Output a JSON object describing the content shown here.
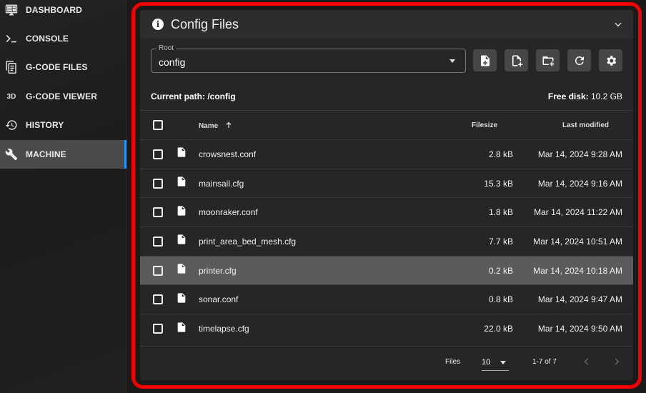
{
  "sidebar": {
    "items": [
      {
        "label": "DASHBOARD",
        "icon": "monitor-dashboard-icon"
      },
      {
        "label": "CONSOLE",
        "icon": "console-icon"
      },
      {
        "label": "G-CODE FILES",
        "icon": "file-document-icon"
      },
      {
        "label": "G-CODE VIEWER",
        "icon": "3d-icon",
        "icon_text": "3D"
      },
      {
        "label": "HISTORY",
        "icon": "history-icon"
      },
      {
        "label": "MACHINE",
        "icon": "wrench-icon",
        "active": true
      }
    ]
  },
  "panel": {
    "title": "Config Files",
    "root_label": "Root",
    "root_value": "config",
    "toolbar": [
      "create-file",
      "upload-file",
      "create-folder",
      "refresh",
      "settings"
    ],
    "current_path_label": "Current path: /config",
    "free_disk_label": "Free disk:",
    "free_disk_value": "10.2 GB",
    "columns": {
      "name": "Name",
      "filesize": "Filesize",
      "modified": "Last modified"
    },
    "files": [
      {
        "name": "crowsnest.conf",
        "size": "2.8 kB",
        "modified": "Mar 14, 2024 9:28 AM"
      },
      {
        "name": "mainsail.cfg",
        "size": "15.3 kB",
        "modified": "Mar 14, 2024 9:16 AM"
      },
      {
        "name": "moonraker.conf",
        "size": "1.8 kB",
        "modified": "Mar 14, 2024 11:22 AM"
      },
      {
        "name": "print_area_bed_mesh.cfg",
        "size": "7.7 kB",
        "modified": "Mar 14, 2024 10:51 AM"
      },
      {
        "name": "printer.cfg",
        "size": "0.2 kB",
        "modified": "Mar 14, 2024 10:18 AM",
        "selected": true
      },
      {
        "name": "sonar.conf",
        "size": "0.8 kB",
        "modified": "Mar 14, 2024 9:47 AM"
      },
      {
        "name": "timelapse.cfg",
        "size": "22.0 kB",
        "modified": "Mar 14, 2024 9:50 AM"
      }
    ],
    "footer": {
      "files_label": "Files",
      "per_page": "10",
      "range": "1-7 of 7"
    }
  },
  "colors": {
    "accent": "#2196f3",
    "highlight": "#f40000"
  }
}
